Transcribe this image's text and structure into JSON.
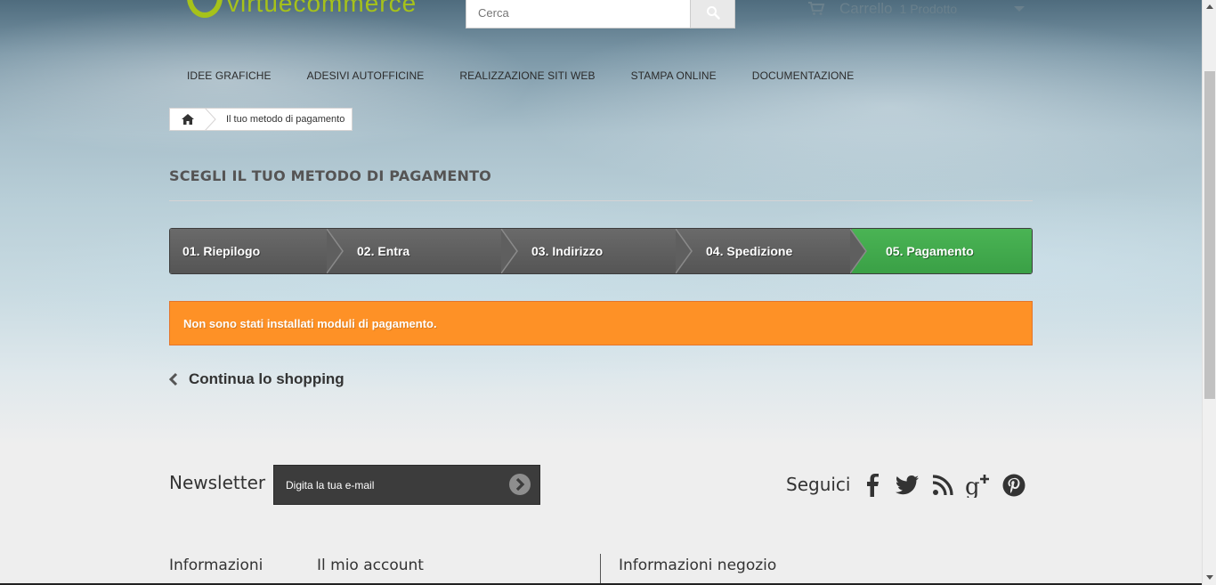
{
  "header": {
    "logo_text": "virtuecommerce",
    "search": {
      "placeholder": "Cerca"
    },
    "cart": {
      "label": "Carrello",
      "count": "1 Prodotto"
    }
  },
  "nav": {
    "items": [
      {
        "label": "IDEE GRAFICHE"
      },
      {
        "label": "ADESIVI AUTOFFICINE"
      },
      {
        "label": "REALIZZAZIONE SITI WEB"
      },
      {
        "label": "STAMPA ONLINE"
      },
      {
        "label": "DOCUMENTAZIONE"
      }
    ]
  },
  "breadcrumb": {
    "current": "Il tuo metodo di pagamento"
  },
  "page": {
    "title": "SCEGLI IL TUO METODO DI PAGAMENTO",
    "steps": [
      {
        "label": "01. Riepilogo"
      },
      {
        "label": "02. Entra"
      },
      {
        "label": "03. Indirizzo"
      },
      {
        "label": "04. Spedizione"
      },
      {
        "label": "05. Pagamento",
        "active": true
      }
    ],
    "alert": "Non sono stati installati moduli di pagamento.",
    "continue_label": "Continua lo shopping"
  },
  "footer": {
    "newsletter": {
      "title": "Newsletter",
      "placeholder": "Digita la tua e-mail"
    },
    "follow": {
      "label": "Seguici",
      "icons": [
        "facebook-icon",
        "twitter-icon",
        "rss-icon",
        "google-plus-icon",
        "pinterest-icon"
      ]
    },
    "columns": [
      "Informazioni",
      "Il mio account",
      "Informazioni negozio"
    ]
  },
  "colors": {
    "step_active": "#3aa046",
    "step_inactive": "#555555",
    "alert": "#fe9126",
    "logo": "#a6c21a"
  }
}
